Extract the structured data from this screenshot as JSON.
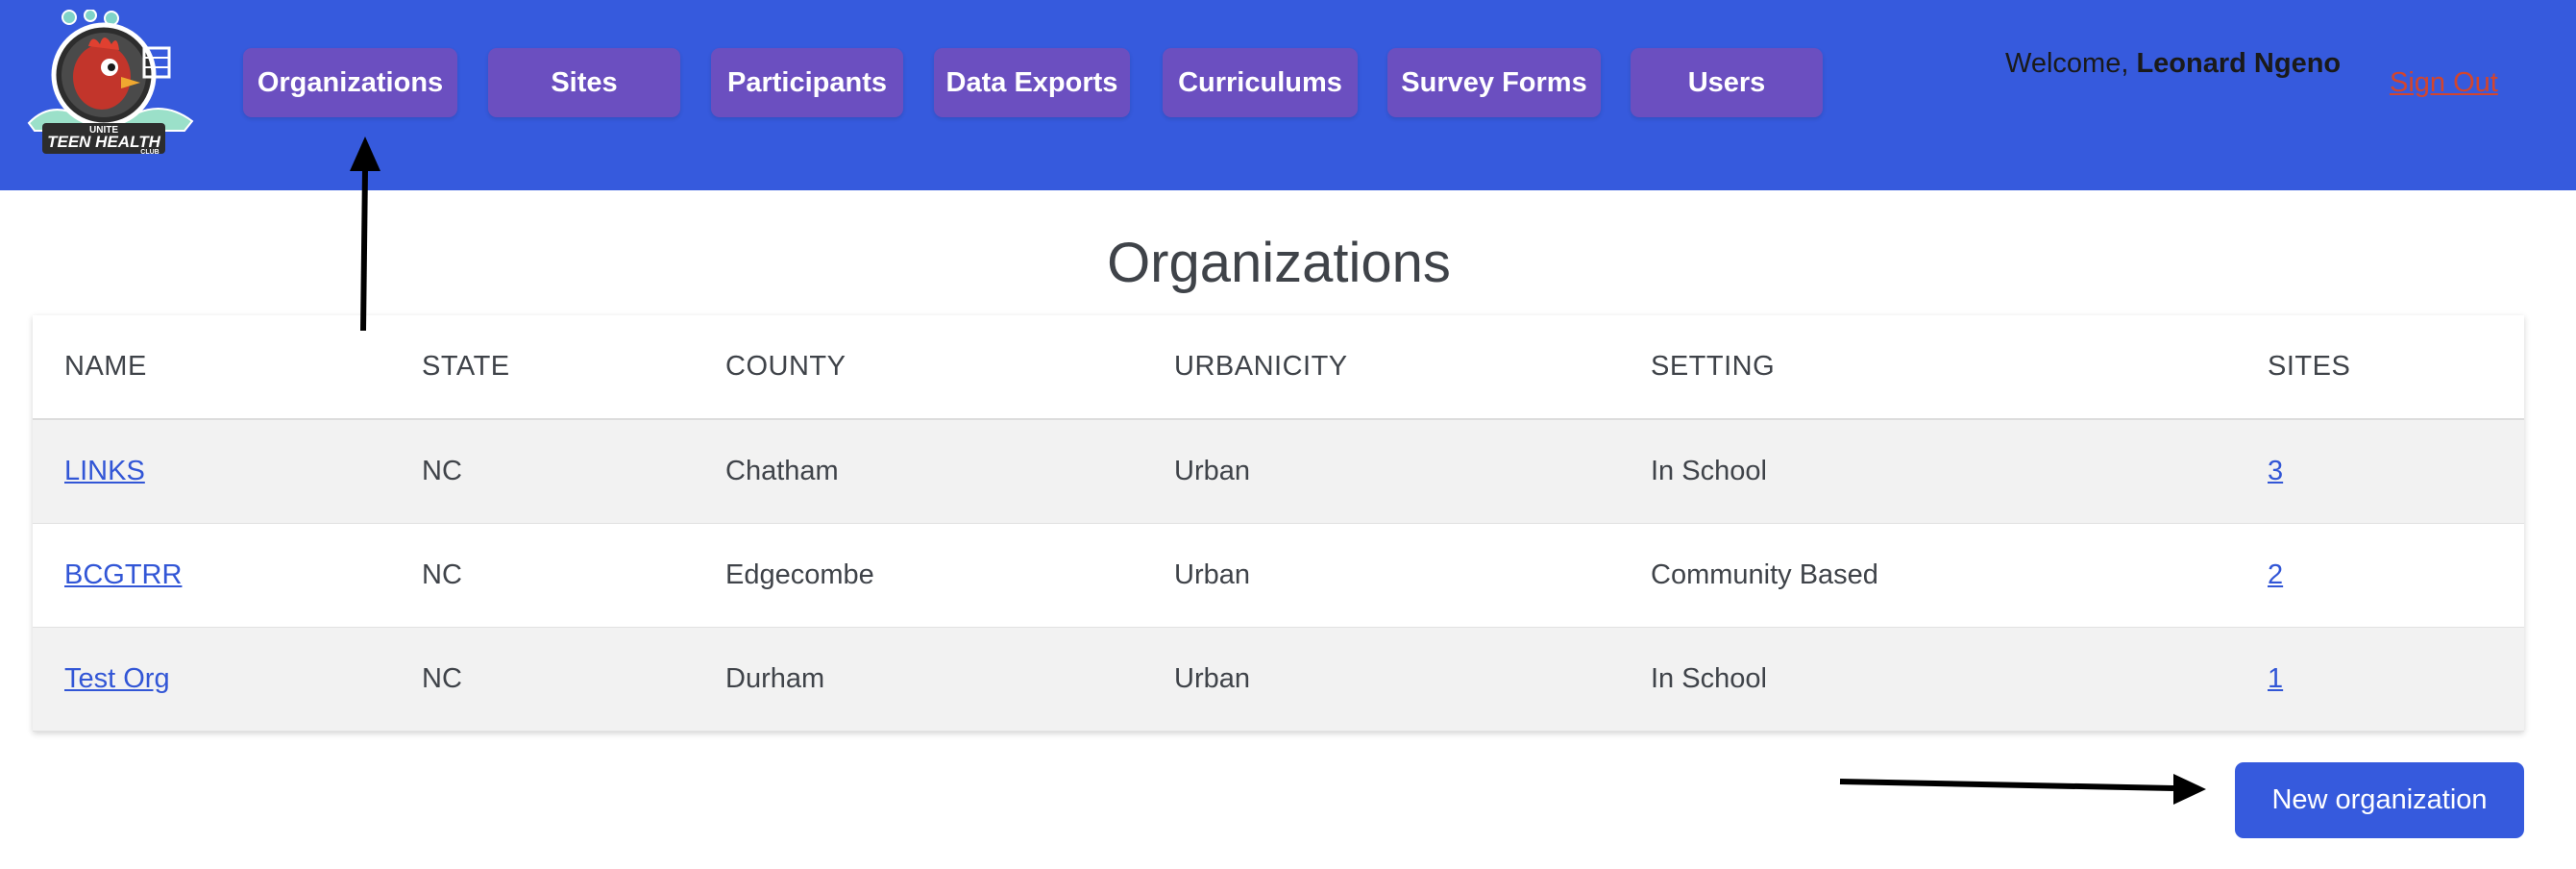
{
  "header": {
    "logo": {
      "icon": "teen-health-club-logo",
      "text_top": "UNITE",
      "text_main": "TEEN HEALTH",
      "text_sub": "CLUB"
    },
    "nav": [
      {
        "label": "Organizations"
      },
      {
        "label": "Sites"
      },
      {
        "label": "Participants"
      },
      {
        "label": "Data Exports"
      },
      {
        "label": "Curriculums"
      },
      {
        "label": "Survey Forms"
      },
      {
        "label": "Users"
      }
    ],
    "welcome_prefix": "Welcome, ",
    "user_name": "Leonard Ngeno",
    "sign_out": "Sign Out"
  },
  "main": {
    "title": "Organizations",
    "columns": [
      "NAME",
      "STATE",
      "COUNTY",
      "URBANICITY",
      "SETTING",
      "SITES"
    ],
    "rows": [
      {
        "name": "LINKS",
        "state": "NC",
        "county": "Chatham",
        "urbanicity": "Urban",
        "setting": "In School",
        "sites": "3"
      },
      {
        "name": "BCGTRR",
        "state": "NC",
        "county": "Edgecombe",
        "urbanicity": "Urban",
        "setting": "Community Based",
        "sites": "2"
      },
      {
        "name": "Test Org",
        "state": "NC",
        "county": "Durham",
        "urbanicity": "Urban",
        "setting": "In School",
        "sites": "1"
      }
    ],
    "new_button": "New organization"
  },
  "colors": {
    "header_bg": "#365ADD",
    "nav_button_bg": "#6B4FC0",
    "link": "#3256D6",
    "sign_out": "#D2452E",
    "primary_button": "#365ADD"
  },
  "annotations": {
    "arrow_icon": "arrow-icon"
  }
}
